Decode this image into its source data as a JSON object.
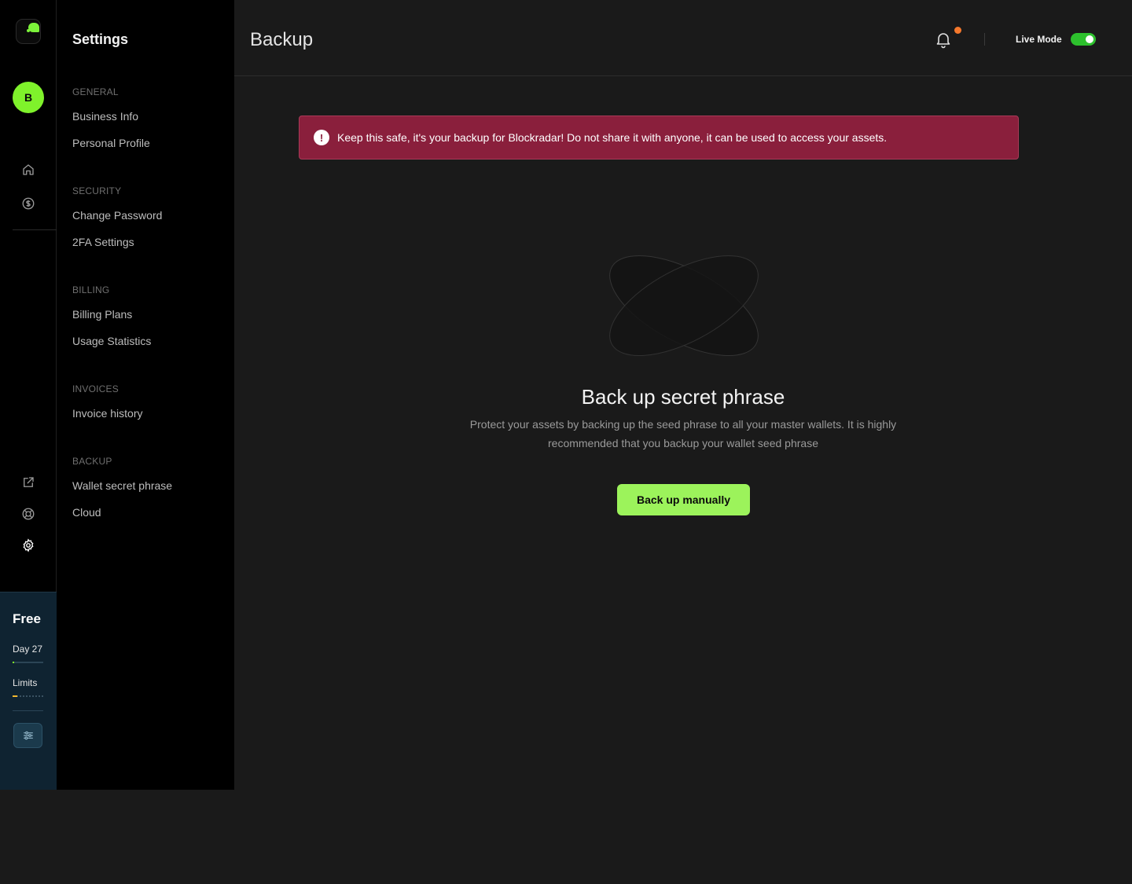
{
  "rail": {
    "avatar_initial": "B",
    "plan": {
      "name": "Free",
      "day_label": "Day 27",
      "day_progress": 0.05,
      "limits_label": "Limits",
      "limits_progress": 0.15
    }
  },
  "sidebar": {
    "title": "Settings",
    "sections": [
      {
        "label": "GENERAL",
        "items": [
          "Business Info",
          "Personal Profile"
        ]
      },
      {
        "label": "SECURITY",
        "items": [
          "Change Password",
          "2FA Settings"
        ]
      },
      {
        "label": "BILLING",
        "items": [
          "Billing Plans",
          "Usage Statistics"
        ]
      },
      {
        "label": "INVOICES",
        "items": [
          "Invoice history"
        ]
      },
      {
        "label": "BACKUP",
        "items": [
          "Wallet secret phrase",
          "Cloud"
        ]
      }
    ]
  },
  "header": {
    "title": "Backup",
    "live_mode_label": "Live Mode",
    "live_mode_on": true,
    "notification_badge_color": "#f5782c"
  },
  "alert": {
    "icon": "!",
    "text": "Keep this safe, it's your backup for Blockradar! Do not share it with anyone, it can be used to access your assets."
  },
  "empty_state": {
    "title": "Back up secret phrase",
    "description": "Protect your assets by backing up the seed phrase to all your master wallets. It is highly recommended that you backup your wallet seed phrase",
    "button_label": "Back up manually"
  },
  "colors": {
    "accent": "#9cf35b",
    "alert_bg": "#8a1f3c",
    "plan_bg": "#0f2331",
    "toggle_on": "#2dc02d"
  }
}
